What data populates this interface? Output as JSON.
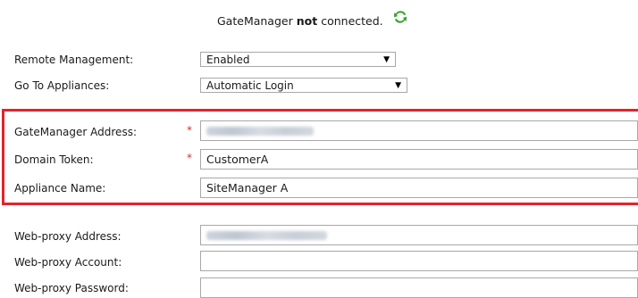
{
  "status": {
    "prefix": "GateManager",
    "bold": "not",
    "suffix": "connected.",
    "refresh_icon": "refresh-icon",
    "refresh_color": "#3aa52e"
  },
  "fields": {
    "remote_management": {
      "label": "Remote Management:",
      "value": "Enabled"
    },
    "go_to_appliances": {
      "label": "Go To Appliances:",
      "value": "Automatic Login"
    },
    "gatemanager_address": {
      "label": "GateManager Address:",
      "required": "*",
      "value_redacted": true
    },
    "domain_token": {
      "label": "Domain Token:",
      "required": "*",
      "value": "CustomerA"
    },
    "appliance_name": {
      "label": "Appliance Name:",
      "value": "SiteManager A"
    },
    "web_proxy_address": {
      "label": "Web-proxy Address:",
      "value_redacted": true
    },
    "web_proxy_account": {
      "label": "Web-proxy Account:",
      "value": ""
    },
    "web_proxy_password": {
      "label": "Web-proxy Password:",
      "value": ""
    }
  },
  "highlight_color": "#e3232c"
}
